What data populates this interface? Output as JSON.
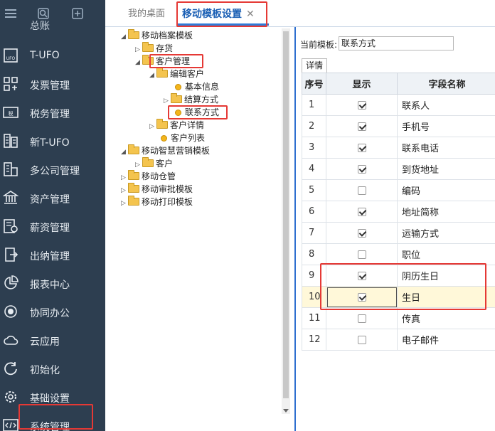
{
  "sidebar": {
    "top_cut_label": "总账",
    "items": [
      {
        "label": "T-UFO",
        "icon": "ufo-icon"
      },
      {
        "label": "发票管理",
        "icon": "invoice-icon"
      },
      {
        "label": "税务管理",
        "icon": "tax-icon"
      },
      {
        "label": "新T-UFO",
        "icon": "new-ufo-icon"
      },
      {
        "label": "多公司管理",
        "icon": "multi-company-icon"
      },
      {
        "label": "资产管理",
        "icon": "asset-icon"
      },
      {
        "label": "薪资管理",
        "icon": "salary-icon"
      },
      {
        "label": "出纳管理",
        "icon": "cashier-icon"
      },
      {
        "label": "报表中心",
        "icon": "report-icon"
      },
      {
        "label": "协同办公",
        "icon": "collab-icon"
      },
      {
        "label": "云应用",
        "icon": "cloud-icon"
      },
      {
        "label": "初始化",
        "icon": "init-icon"
      },
      {
        "label": "基础设置",
        "icon": "settings-gear-icon"
      },
      {
        "label": "系统管理",
        "icon": "code-icon"
      }
    ]
  },
  "tabs": {
    "desktop": "我的桌面",
    "active": "移动模板设置",
    "close": "✕"
  },
  "tree": {
    "nodes": [
      {
        "label": "移动档案模板"
      },
      {
        "label": "存货"
      },
      {
        "label": "客户管理"
      },
      {
        "label": "编辑客户"
      },
      {
        "label": "基本信息"
      },
      {
        "label": "结算方式"
      },
      {
        "label": "联系方式"
      },
      {
        "label": "客户详情"
      },
      {
        "label": "客户列表"
      },
      {
        "label": "移动智慧营销模板"
      },
      {
        "label": "客户"
      },
      {
        "label": "移动仓管"
      },
      {
        "label": "移动审批模板"
      },
      {
        "label": "移动打印模板"
      }
    ]
  },
  "detail": {
    "current_template_label": "当前模板:",
    "current_template_value": "联系方式",
    "tab_label": "详情",
    "columns": [
      "序号",
      "显示",
      "字段名称"
    ],
    "rows": [
      {
        "no": "1",
        "show": true,
        "field": "联系人"
      },
      {
        "no": "2",
        "show": true,
        "field": "手机号"
      },
      {
        "no": "3",
        "show": true,
        "field": "联系电话"
      },
      {
        "no": "4",
        "show": true,
        "field": "到货地址"
      },
      {
        "no": "5",
        "show": false,
        "field": "编码"
      },
      {
        "no": "6",
        "show": true,
        "field": "地址简称"
      },
      {
        "no": "7",
        "show": true,
        "field": "运输方式"
      },
      {
        "no": "8",
        "show": false,
        "field": "职位"
      },
      {
        "no": "9",
        "show": true,
        "field": "阴历生日"
      },
      {
        "no": "10",
        "show": true,
        "field": "生日"
      },
      {
        "no": "11",
        "show": false,
        "field": "传真"
      },
      {
        "no": "12",
        "show": false,
        "field": "电子邮件"
      }
    ]
  }
}
